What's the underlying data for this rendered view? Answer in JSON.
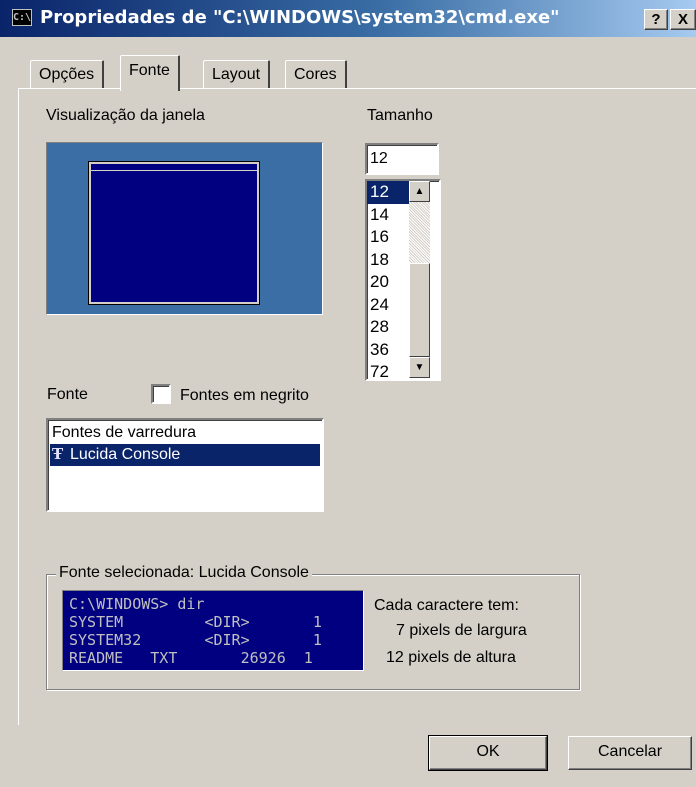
{
  "window": {
    "title": "Propriedades de \"C:\\WINDOWS\\system32\\cmd.exe\"",
    "title_icon": "C:\\",
    "help_button": "?",
    "close_button": "X"
  },
  "tabs": [
    {
      "label": "Opções"
    },
    {
      "label": "Fonte",
      "active": true
    },
    {
      "label": "Layout"
    },
    {
      "label": "Cores"
    }
  ],
  "preview": {
    "label": "Visualização da janela"
  },
  "size": {
    "label": "Tamanho",
    "value": "12",
    "options": [
      "12",
      "14",
      "16",
      "18",
      "20",
      "24",
      "28",
      "36",
      "72"
    ],
    "selected": "12"
  },
  "font": {
    "label": "Fonte",
    "bold_checkbox_label": "Fontes em negrito",
    "bold_checked": false,
    "items": [
      "Fontes de varredura",
      "Lucida Console"
    ],
    "selected": "Lucida Console"
  },
  "selected_font": {
    "group_label": "Fonte selecionada: Lucida Console",
    "sample_lines": [
      "C:\\WINDOWS> dir",
      "SYSTEM         <DIR>       1",
      "SYSTEM32       <DIR>       1",
      "README   TXT       26926  1"
    ],
    "info_heading": "Cada caractere tem:",
    "width_info": "7 pixels de largura",
    "height_info": "12 pixels de altura"
  },
  "buttons": {
    "ok": "OK",
    "cancel": "Cancelar"
  },
  "colors": {
    "title_start": "#0a246a",
    "title_end": "#a6caf0",
    "selection": "#0a246a",
    "console_bg": "#000080",
    "preview_bg": "#3a6ea5"
  }
}
